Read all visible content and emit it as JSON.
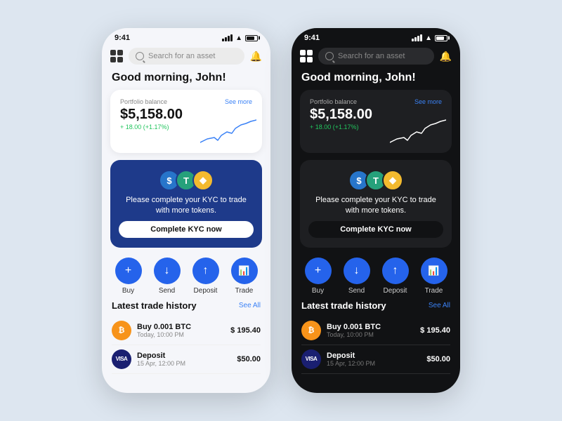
{
  "light": {
    "theme": "light",
    "status": {
      "time": "9:41"
    },
    "search": {
      "placeholder": "Search for an asset"
    },
    "greeting": "Good morning, John!",
    "portfolio": {
      "label": "Portfolio balance",
      "see_more": "See more",
      "amount": "$5,158.00",
      "change": "+ 18.00 (+1.17%)"
    },
    "kyc": {
      "text": "Please complete your KYC to trade\nwith more tokens.",
      "button": "Complete KYC now"
    },
    "actions": [
      {
        "label": "Buy",
        "icon": "+"
      },
      {
        "label": "Send",
        "icon": "↓"
      },
      {
        "label": "Deposit",
        "icon": "↑"
      },
      {
        "label": "Trade",
        "icon": "📊"
      }
    ],
    "history": {
      "title": "Latest trade history",
      "see_all": "See All",
      "items": [
        {
          "name": "Buy 0.001 BTC",
          "date": "Today, 10:00 PM",
          "amount": "$ 195.40",
          "type": "btc"
        },
        {
          "name": "Deposit",
          "date": "15 Apr, 12:00 PM",
          "amount": "$50.00",
          "type": "visa"
        }
      ]
    }
  },
  "dark": {
    "theme": "dark",
    "status": {
      "time": "9:41"
    },
    "search": {
      "placeholder": "Search for an asset"
    },
    "greeting": "Good morning, John!",
    "portfolio": {
      "label": "Portfolio balance",
      "see_more": "See more",
      "amount": "$5,158.00",
      "change": "+ 18.00 (+1.17%)"
    },
    "kyc": {
      "text": "Please complete your KYC to trade\nwith more tokens.",
      "button": "Complete KYC now"
    },
    "actions": [
      {
        "label": "Buy",
        "icon": "+"
      },
      {
        "label": "Send",
        "icon": "↓"
      },
      {
        "label": "Deposit",
        "icon": "↑"
      },
      {
        "label": "Trade",
        "icon": "📊"
      }
    ],
    "history": {
      "title": "Latest trade history",
      "see_all": "See All",
      "items": [
        {
          "name": "Buy 0.001 BTC",
          "date": "Today, 10:00 PM",
          "amount": "$ 195.40",
          "type": "btc"
        },
        {
          "name": "Deposit",
          "date": "15 Apr, 12:00 PM",
          "amount": "$50.00",
          "type": "visa"
        }
      ]
    }
  }
}
